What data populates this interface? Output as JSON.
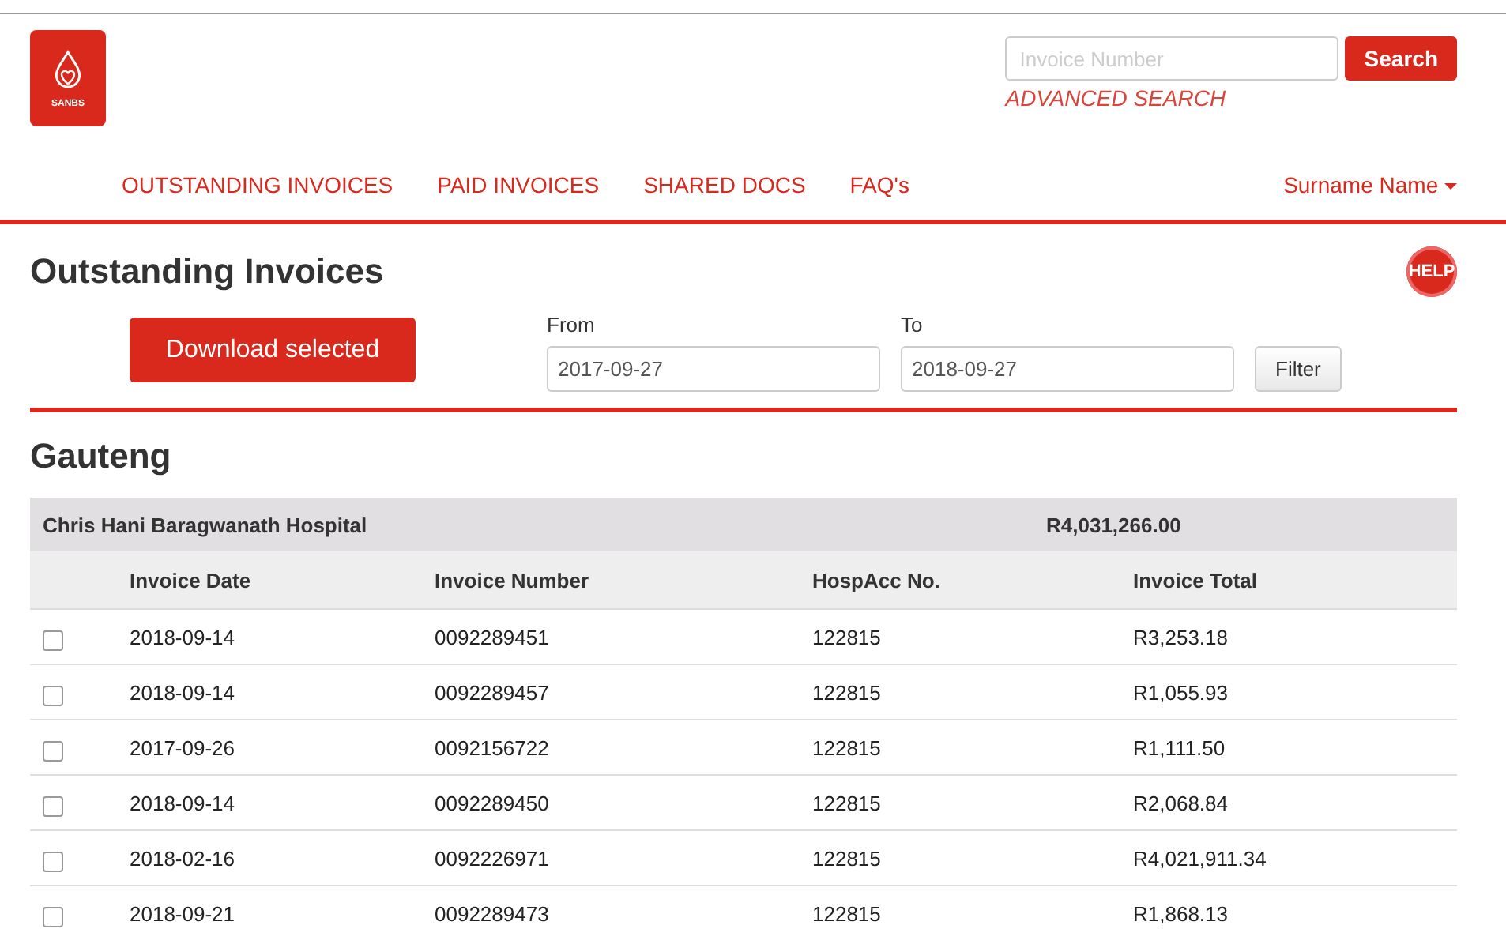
{
  "header": {
    "logo": "SANBS",
    "search": {
      "placeholder": "Invoice Number",
      "button": "Search"
    },
    "advanced_search": "ADVANCED SEARCH"
  },
  "nav": {
    "items": [
      {
        "label": "OUTSTANDING INVOICES"
      },
      {
        "label": "PAID INVOICES"
      },
      {
        "label": "SHARED DOCS"
      },
      {
        "label": "FAQ's"
      }
    ],
    "user": "Surname Name"
  },
  "page_title": "Outstanding Invoices",
  "help": "HELP",
  "download_button": "Download selected",
  "filter": {
    "from_label": "From",
    "from_value": "2017-09-27",
    "to_label": "To",
    "to_value": "2018-09-27",
    "button": "Filter"
  },
  "region": "Gauteng",
  "table": {
    "group": {
      "name": "Chris Hani Baragwanath Hospital",
      "total": "R4,031,266.00"
    },
    "columns": [
      "Invoice Date",
      "Invoice Number",
      "HospAcc No.",
      "Invoice Total"
    ],
    "rows": [
      {
        "checked": false,
        "cells": [
          "2018-09-14",
          "0092289451",
          "122815",
          "R3,253.18"
        ]
      },
      {
        "checked": false,
        "cells": [
          "2018-09-14",
          "0092289457",
          "122815",
          "R1,055.93"
        ]
      },
      {
        "checked": false,
        "cells": [
          "2017-09-26",
          "0092156722",
          "122815",
          "R1,111.50"
        ]
      },
      {
        "checked": false,
        "cells": [
          "2018-09-14",
          "0092289450",
          "122815",
          "R2,068.84"
        ]
      },
      {
        "checked": false,
        "cells": [
          "2018-02-16",
          "0092226971",
          "122815",
          "R4,021,911.34"
        ]
      },
      {
        "checked": false,
        "cells": [
          "2018-09-21",
          "0092289473",
          "122815",
          "R1,868.13"
        ]
      }
    ]
  }
}
